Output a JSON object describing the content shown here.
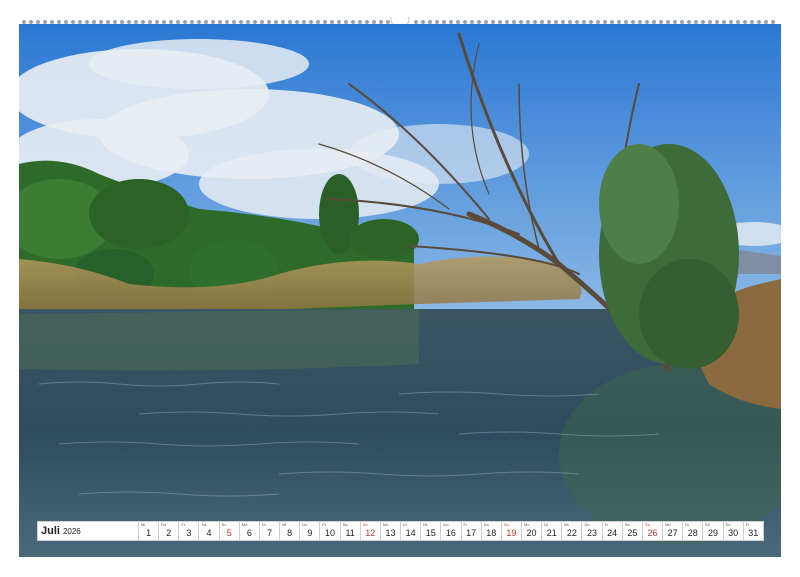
{
  "calendar": {
    "month": "Juli",
    "year": "2026",
    "weekday_abbrevs": [
      "Mi",
      "Do",
      "Fr",
      "Sa",
      "So",
      "Mo",
      "Di"
    ],
    "first_weekday_index": 0,
    "sunday_index": 4,
    "days": [
      "1",
      "2",
      "3",
      "4",
      "5",
      "6",
      "7",
      "8",
      "9",
      "10",
      "11",
      "12",
      "13",
      "14",
      "15",
      "16",
      "17",
      "18",
      "19",
      "20",
      "21",
      "22",
      "23",
      "24",
      "25",
      "26",
      "27",
      "28",
      "29",
      "30",
      "31"
    ],
    "sunday_color": "#c0392b"
  },
  "photo": {
    "scene": "river-with-leaning-tree",
    "sky_color": "#2f7fd6",
    "water_color": "#3d5a68",
    "foliage_color": "#2f6a2a"
  }
}
